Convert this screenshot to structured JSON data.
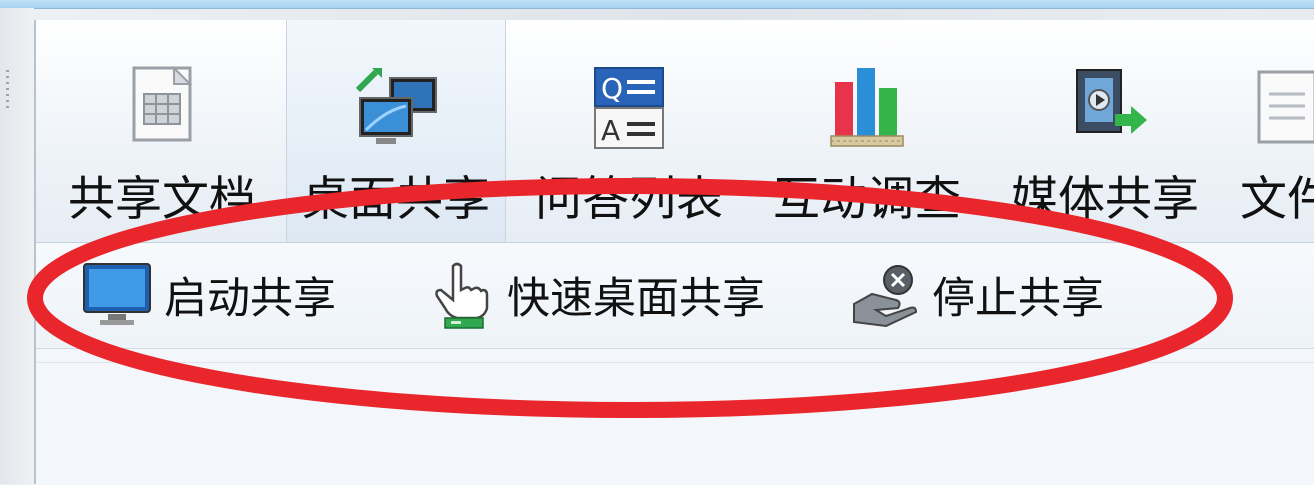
{
  "toolbar": {
    "items": [
      {
        "label": "共享文档",
        "icon": "shared-document-icon"
      },
      {
        "label": "桌面共享",
        "icon": "desktop-share-icon"
      },
      {
        "label": "问答列表",
        "icon": "qa-list-icon"
      },
      {
        "label": "互动调查",
        "icon": "survey-chart-icon"
      },
      {
        "label": "媒体共享",
        "icon": "media-share-icon"
      },
      {
        "label": "文件",
        "icon": "file-icon"
      }
    ]
  },
  "subbar": {
    "items": [
      {
        "label": "启动共享",
        "icon": "monitor-icon"
      },
      {
        "label": "快速桌面共享",
        "icon": "hand-pointer-icon"
      },
      {
        "label": "停止共享",
        "icon": "stop-share-icon"
      }
    ]
  },
  "annotation": {
    "color": "#e8262b",
    "shape": "ellipse"
  }
}
